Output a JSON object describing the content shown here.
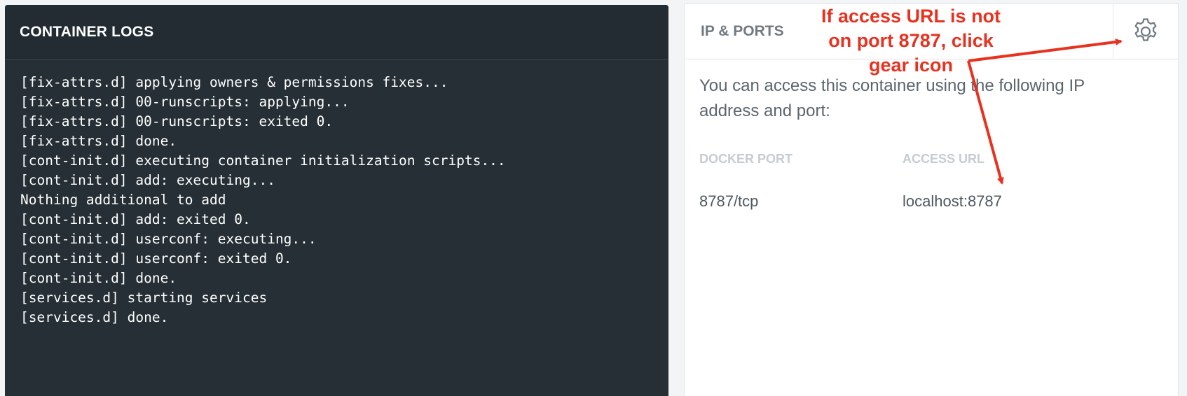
{
  "logs": {
    "title": "CONTAINER LOGS",
    "lines": [
      "[fix-attrs.d] applying owners & permissions fixes...",
      "[fix-attrs.d] 00-runscripts: applying...",
      "[fix-attrs.d] 00-runscripts: exited 0.",
      "[fix-attrs.d] done.",
      "[cont-init.d] executing container initialization scripts...",
      "[cont-init.d] add: executing...",
      "Nothing additional to add",
      "[cont-init.d] add: exited 0.",
      "[cont-init.d] userconf: executing...",
      "[cont-init.d] userconf: exited 0.",
      "[cont-init.d] done.",
      "[services.d] starting services",
      "[services.d] done."
    ]
  },
  "ports": {
    "title": "IP & PORTS",
    "settings_icon": "gear-icon",
    "description": "You can access this container using the following IP address and port:",
    "columns": {
      "docker_port": "DOCKER PORT",
      "access_url": "ACCESS URL"
    },
    "rows": [
      {
        "docker_port": "8787/tcp",
        "access_url": "localhost:8787"
      }
    ]
  },
  "annotation": {
    "lines": [
      "If access URL is not",
      "on port 8787, click",
      "gear icon"
    ],
    "color": "#e8321f"
  }
}
